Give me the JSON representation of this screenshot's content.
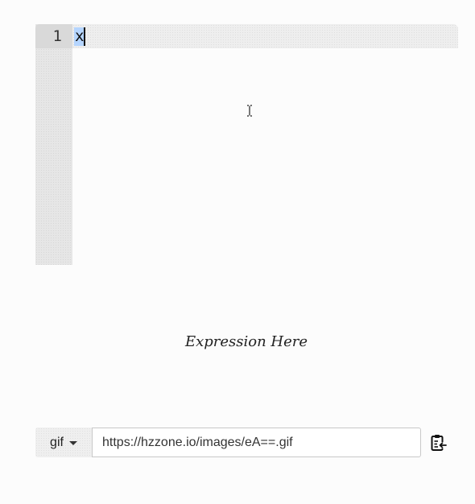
{
  "editor": {
    "lines": [
      {
        "number": "1",
        "text": "x"
      }
    ]
  },
  "preview": {
    "text": "Expression Here"
  },
  "export": {
    "format_label": "gif",
    "url_value": "https://hzzone.io/images/eA==.gif",
    "copy_icon": "clipboard-copy-icon"
  }
}
